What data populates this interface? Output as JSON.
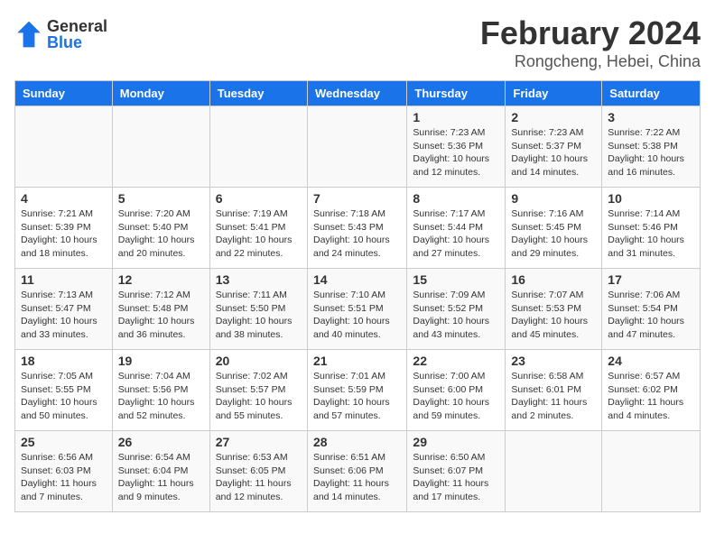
{
  "header": {
    "logo_general": "General",
    "logo_blue": "Blue",
    "month_year": "February 2024",
    "location": "Rongcheng, Hebei, China"
  },
  "calendar": {
    "days_of_week": [
      "Sunday",
      "Monday",
      "Tuesday",
      "Wednesday",
      "Thursday",
      "Friday",
      "Saturday"
    ],
    "weeks": [
      [
        {
          "day": "",
          "info": ""
        },
        {
          "day": "",
          "info": ""
        },
        {
          "day": "",
          "info": ""
        },
        {
          "day": "",
          "info": ""
        },
        {
          "day": "1",
          "info": "Sunrise: 7:23 AM\nSunset: 5:36 PM\nDaylight: 10 hours\nand 12 minutes."
        },
        {
          "day": "2",
          "info": "Sunrise: 7:23 AM\nSunset: 5:37 PM\nDaylight: 10 hours\nand 14 minutes."
        },
        {
          "day": "3",
          "info": "Sunrise: 7:22 AM\nSunset: 5:38 PM\nDaylight: 10 hours\nand 16 minutes."
        }
      ],
      [
        {
          "day": "4",
          "info": "Sunrise: 7:21 AM\nSunset: 5:39 PM\nDaylight: 10 hours\nand 18 minutes."
        },
        {
          "day": "5",
          "info": "Sunrise: 7:20 AM\nSunset: 5:40 PM\nDaylight: 10 hours\nand 20 minutes."
        },
        {
          "day": "6",
          "info": "Sunrise: 7:19 AM\nSunset: 5:41 PM\nDaylight: 10 hours\nand 22 minutes."
        },
        {
          "day": "7",
          "info": "Sunrise: 7:18 AM\nSunset: 5:43 PM\nDaylight: 10 hours\nand 24 minutes."
        },
        {
          "day": "8",
          "info": "Sunrise: 7:17 AM\nSunset: 5:44 PM\nDaylight: 10 hours\nand 27 minutes."
        },
        {
          "day": "9",
          "info": "Sunrise: 7:16 AM\nSunset: 5:45 PM\nDaylight: 10 hours\nand 29 minutes."
        },
        {
          "day": "10",
          "info": "Sunrise: 7:14 AM\nSunset: 5:46 PM\nDaylight: 10 hours\nand 31 minutes."
        }
      ],
      [
        {
          "day": "11",
          "info": "Sunrise: 7:13 AM\nSunset: 5:47 PM\nDaylight: 10 hours\nand 33 minutes."
        },
        {
          "day": "12",
          "info": "Sunrise: 7:12 AM\nSunset: 5:48 PM\nDaylight: 10 hours\nand 36 minutes."
        },
        {
          "day": "13",
          "info": "Sunrise: 7:11 AM\nSunset: 5:50 PM\nDaylight: 10 hours\nand 38 minutes."
        },
        {
          "day": "14",
          "info": "Sunrise: 7:10 AM\nSunset: 5:51 PM\nDaylight: 10 hours\nand 40 minutes."
        },
        {
          "day": "15",
          "info": "Sunrise: 7:09 AM\nSunset: 5:52 PM\nDaylight: 10 hours\nand 43 minutes."
        },
        {
          "day": "16",
          "info": "Sunrise: 7:07 AM\nSunset: 5:53 PM\nDaylight: 10 hours\nand 45 minutes."
        },
        {
          "day": "17",
          "info": "Sunrise: 7:06 AM\nSunset: 5:54 PM\nDaylight: 10 hours\nand 47 minutes."
        }
      ],
      [
        {
          "day": "18",
          "info": "Sunrise: 7:05 AM\nSunset: 5:55 PM\nDaylight: 10 hours\nand 50 minutes."
        },
        {
          "day": "19",
          "info": "Sunrise: 7:04 AM\nSunset: 5:56 PM\nDaylight: 10 hours\nand 52 minutes."
        },
        {
          "day": "20",
          "info": "Sunrise: 7:02 AM\nSunset: 5:57 PM\nDaylight: 10 hours\nand 55 minutes."
        },
        {
          "day": "21",
          "info": "Sunrise: 7:01 AM\nSunset: 5:59 PM\nDaylight: 10 hours\nand 57 minutes."
        },
        {
          "day": "22",
          "info": "Sunrise: 7:00 AM\nSunset: 6:00 PM\nDaylight: 10 hours\nand 59 minutes."
        },
        {
          "day": "23",
          "info": "Sunrise: 6:58 AM\nSunset: 6:01 PM\nDaylight: 11 hours\nand 2 minutes."
        },
        {
          "day": "24",
          "info": "Sunrise: 6:57 AM\nSunset: 6:02 PM\nDaylight: 11 hours\nand 4 minutes."
        }
      ],
      [
        {
          "day": "25",
          "info": "Sunrise: 6:56 AM\nSunset: 6:03 PM\nDaylight: 11 hours\nand 7 minutes."
        },
        {
          "day": "26",
          "info": "Sunrise: 6:54 AM\nSunset: 6:04 PM\nDaylight: 11 hours\nand 9 minutes."
        },
        {
          "day": "27",
          "info": "Sunrise: 6:53 AM\nSunset: 6:05 PM\nDaylight: 11 hours\nand 12 minutes."
        },
        {
          "day": "28",
          "info": "Sunrise: 6:51 AM\nSunset: 6:06 PM\nDaylight: 11 hours\nand 14 minutes."
        },
        {
          "day": "29",
          "info": "Sunrise: 6:50 AM\nSunset: 6:07 PM\nDaylight: 11 hours\nand 17 minutes."
        },
        {
          "day": "",
          "info": ""
        },
        {
          "day": "",
          "info": ""
        }
      ]
    ]
  }
}
